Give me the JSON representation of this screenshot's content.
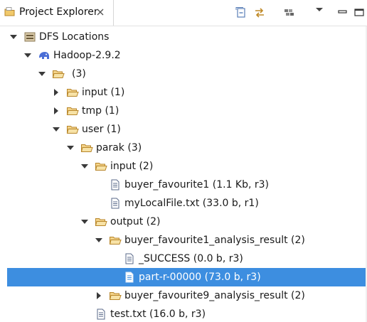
{
  "view": {
    "title": "Project Explorer",
    "toolbar": [
      "collapse-all-icon",
      "link-with-editor-icon",
      "filter-icon",
      "view-menu-icon",
      "minimize-icon",
      "maximize-icon"
    ]
  },
  "colors": {
    "selection": "#3d8ee0",
    "folder": "#e8b24a",
    "elephant": "#4a6ed6"
  },
  "tree": {
    "r0": "DFS Locations",
    "r1": "Hadoop-2.9.2",
    "r2": "(3)",
    "r3": "input (1)",
    "r4": "tmp (1)",
    "r5": "user (1)",
    "r6": "parak (3)",
    "r7": "input (2)",
    "r8": "buyer_favourite1 (1.1 Kb, r3)",
    "r9": "myLocalFile.txt (33.0 b, r1)",
    "r10": "output (2)",
    "r11": "buyer_favourite1_analysis_result (2)",
    "r12": "_SUCCESS (0.0 b, r3)",
    "r13": "part-r-00000 (73.0 b, r3)",
    "r14": "buyer_favourite9_analysis_result (2)",
    "r15": "test.txt (16.0 b, r3)"
  },
  "selected_row": "part-r-00000 (73.0 b, r3)"
}
